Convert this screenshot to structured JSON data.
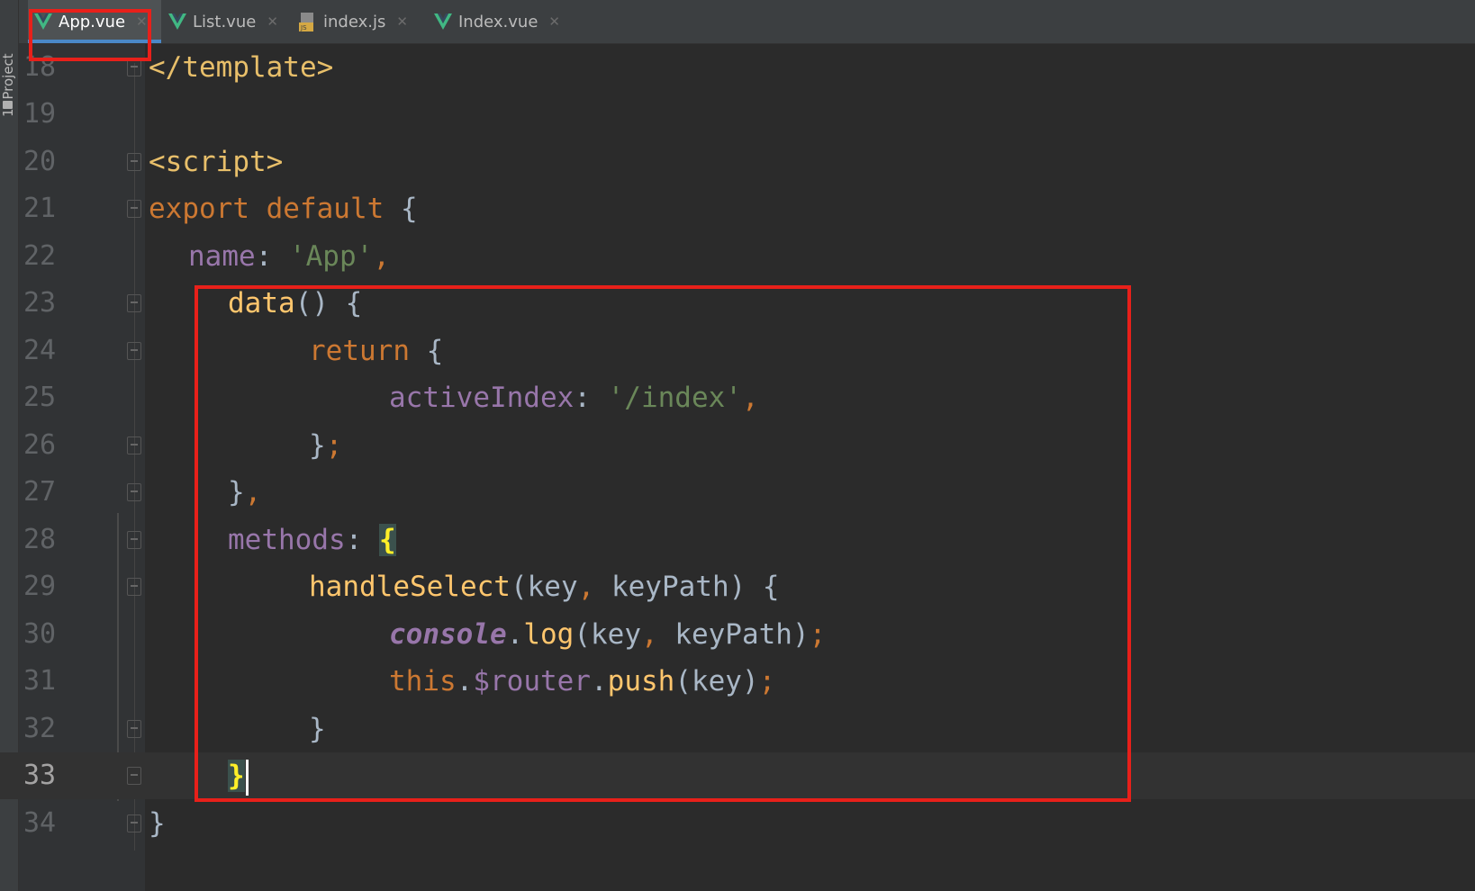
{
  "sidebar": {
    "label": "1: Project"
  },
  "tabs": [
    {
      "label": "App.vue",
      "icon": "vue-icon",
      "active": true
    },
    {
      "label": "List.vue",
      "icon": "vue-icon",
      "active": false
    },
    {
      "label": "index.js",
      "icon": "js-file-icon",
      "active": false
    },
    {
      "label": "Index.vue",
      "icon": "vue-icon",
      "active": false
    }
  ],
  "editor": {
    "lines": [
      {
        "num": "18"
      },
      {
        "num": "19"
      },
      {
        "num": "20"
      },
      {
        "num": "21"
      },
      {
        "num": "22"
      },
      {
        "num": "23"
      },
      {
        "num": "24"
      },
      {
        "num": "25"
      },
      {
        "num": "26"
      },
      {
        "num": "27"
      },
      {
        "num": "28"
      },
      {
        "num": "29"
      },
      {
        "num": "30"
      },
      {
        "num": "31"
      },
      {
        "num": "32"
      },
      {
        "num": "33"
      },
      {
        "num": "34"
      }
    ],
    "code": {
      "l18": "</template>",
      "l20": "<script>",
      "l21_kw": "export default",
      "l21_rest": " {",
      "l22_prop": "name",
      "l22_colon": ": ",
      "l22_str": "'App'",
      "l22_comma": ",",
      "l23_fn": "data",
      "l23_rest": "() {",
      "l24_kw": "return",
      "l24_rest": " {",
      "l25_prop": "activeIndex",
      "l25_colon": ": ",
      "l25_str": "'/index'",
      "l25_comma": ",",
      "l26_brace": "}",
      "l26_semi": ";",
      "l27_brace": "}",
      "l27_comma": ",",
      "l28_prop": "methods",
      "l28_colon": ": ",
      "l28_brace": "{",
      "l29_fn": "handleSelect",
      "l29_a": "(key",
      "l29_comma": ",",
      "l29_b": " keyPath) {",
      "l30_glob": "console",
      "l30_dot": ".",
      "l30_fn": "log",
      "l30_a": "(key",
      "l30_comma": ",",
      "l30_b": " keyPath)",
      "l30_semi": ";",
      "l31_kw": "this",
      "l31_dot": ".",
      "l31_prop": "$router",
      "l31_dot2": ".",
      "l31_fn": "push",
      "l31_a": "(key)",
      "l31_semi": ";",
      "l32_brace": "}",
      "l33_brace": "}",
      "l34_brace": "}"
    }
  },
  "colors": {
    "annotation": "#e8201a",
    "background": "#2b2b2b",
    "vue_green": "#41b883"
  }
}
